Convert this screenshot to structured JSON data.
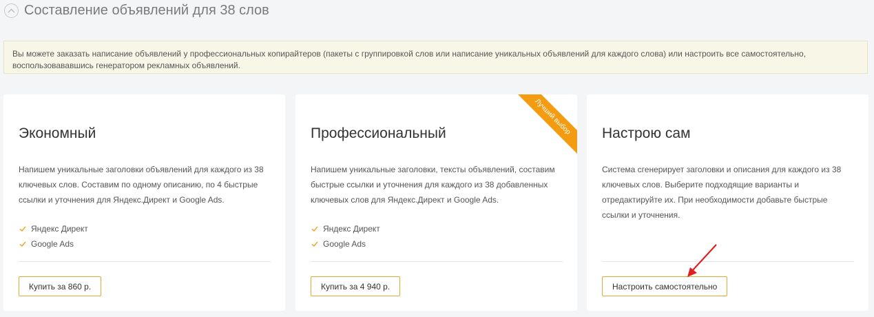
{
  "header": {
    "title": "Составление объявлений для 38 слов"
  },
  "notice": {
    "text": "Вы можете заказать написание объявлений у профессиональных копирайтеров (пакеты с группировкой слов или написание уникальных объявлений для каждого слова) или настроить все самостоятельно, воспользовававшись генератором рекламных объявлений."
  },
  "colors": {
    "accent": "#f39c12",
    "button_border": "#e6a82c",
    "arrow": "#e02020"
  },
  "cards": [
    {
      "title": "Экономный",
      "description": "Напишем уникальные заголовки объявлений для каждого из 38 ключевых слов. Составим по одному описанию, по 4 быстрые ссылки и уточнения для Яндекс.Директ и Google Ads.",
      "features": [
        "Яндекс Директ",
        "Google Ads"
      ],
      "button": "Купить за 860 р."
    },
    {
      "title": "Профессиональный",
      "description": "Напишем уникальные заголовки, тексты объявлений, составим быстрые ссылки и уточнения для каждого из 38 добавленных ключевых слов для Яндекс.Директ и Google Ads.",
      "features": [
        "Яндекс Директ",
        "Google Ads"
      ],
      "button": "Купить за 4 940 р.",
      "ribbon": "Лучший выбор"
    },
    {
      "title": "Настрою сам",
      "description": "Система сгенерирует заголовки и описания для каждого из 38 ключевых слов. Выберите подходящие варианты и отредактируйте их. При необходимости добавьте быстрые ссылки и уточнения.",
      "button": "Настроить самостоятельно"
    }
  ]
}
